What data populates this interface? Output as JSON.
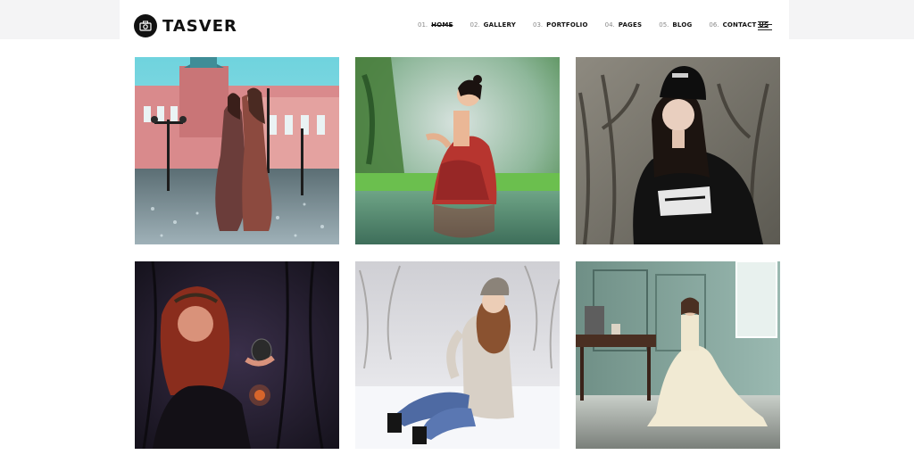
{
  "brand": {
    "name": "TASVER",
    "icon": "camera-icon"
  },
  "nav": {
    "items": [
      {
        "num": "01.",
        "label": "HOME",
        "active": true
      },
      {
        "num": "02.",
        "label": "GALLERY",
        "active": false
      },
      {
        "num": "03.",
        "label": "PORTFOLIO",
        "active": false
      },
      {
        "num": "04.",
        "label": "PAGES",
        "active": false
      },
      {
        "num": "05.",
        "label": "BLOG",
        "active": false
      },
      {
        "num": "06.",
        "label": "CONTACT US",
        "active": false
      }
    ],
    "menu_icon": "hamburger-menu-icon"
  },
  "gallery": {
    "photos": [
      {
        "subject": "two-women-palace-photo"
      },
      {
        "subject": "woman-in-lake-photo"
      },
      {
        "subject": "woman-black-beanie-photo"
      },
      {
        "subject": "woman-red-hair-forest-photo"
      },
      {
        "subject": "woman-sitting-snow-photo"
      },
      {
        "subject": "woman-white-gown-photo"
      }
    ]
  },
  "colors": {
    "accent": "#111111",
    "background": "#ffffff",
    "header_side": "#f4f4f5"
  }
}
